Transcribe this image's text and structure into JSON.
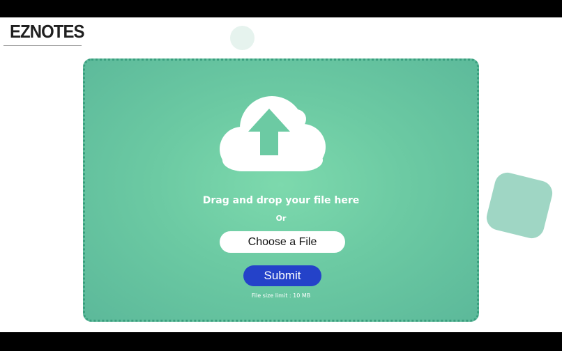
{
  "brand": {
    "logo_text": "EZNOTES"
  },
  "upload": {
    "icon": "cloud-upload-icon",
    "drag_text": "Drag and drop your file here",
    "or_text": "Or",
    "choose_label": "Choose a File",
    "submit_label": "Submit",
    "limit_text": "File size limit : 10 MB"
  },
  "colors": {
    "dropzone_bg": "#6ccaa3",
    "dropzone_border": "#3a9e7e",
    "submit_bg": "#2442c9",
    "icon_color": "#ffffff"
  }
}
